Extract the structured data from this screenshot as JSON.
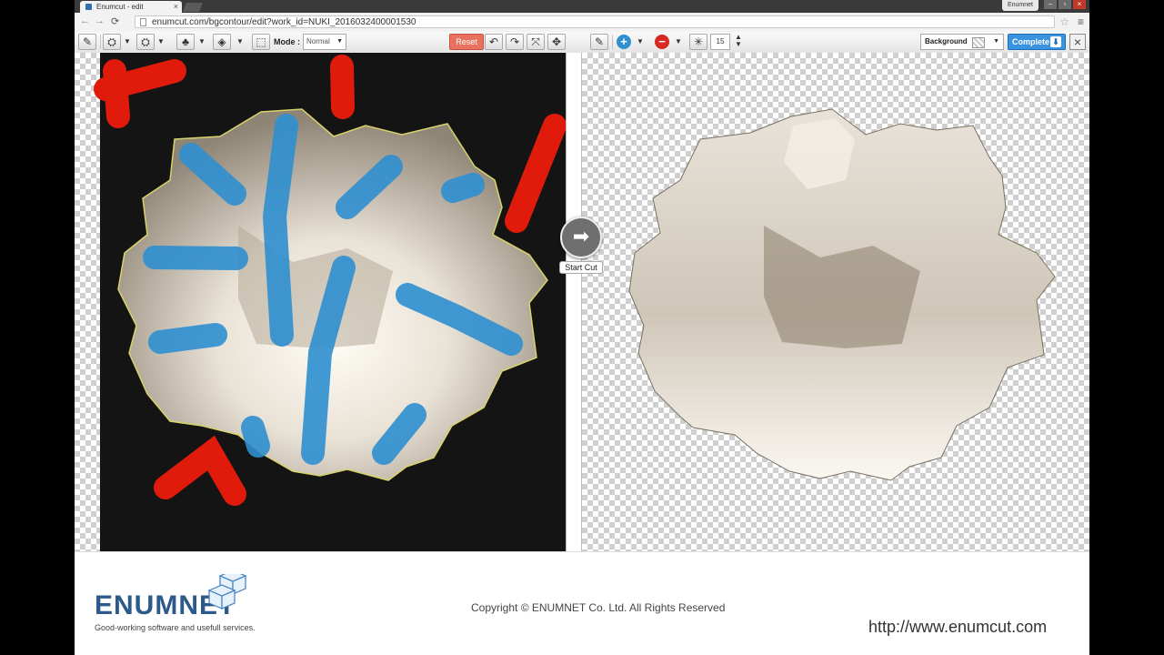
{
  "browser": {
    "tab_title": "Enumcut - edit",
    "user": "Enumnet",
    "url": "enumcut.com/bgcontour/edit?work_id=NUKI_2016032400001530"
  },
  "toolbar": {
    "mode_label": "Mode :",
    "mode_value": "Normal",
    "reset_label": "Reset",
    "brush_size": "15",
    "background_label": "Background",
    "complete_label": "Complete"
  },
  "canvas": {
    "start_cut_label": "Start Cut"
  },
  "colors": {
    "keep_stroke": "#2f8fd0",
    "remove_stroke": "#e01b0b",
    "accent": "#3a93e0",
    "reset": "#e8725f"
  },
  "footer": {
    "logo": "ENUMNET",
    "tagline": "Good-working software and usefull services.",
    "copyright": "Copyright © ENUMNET Co. Ltd. All Rights Reserved",
    "site_url": "http://www.enumcut.com"
  }
}
